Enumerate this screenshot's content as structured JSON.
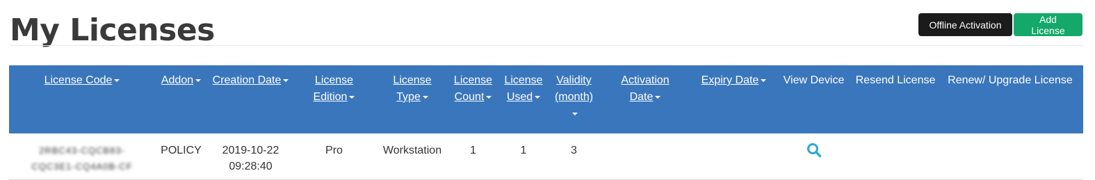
{
  "page": {
    "title": "My Licenses"
  },
  "toolbar": {
    "offline_activation_label": "Offline Activation",
    "add_license_label": "Add License"
  },
  "table": {
    "headers": [
      {
        "line1": "License Code",
        "line2": ""
      },
      {
        "line1": "Addon",
        "line2": ""
      },
      {
        "line1": "Creation Date",
        "line2": ""
      },
      {
        "line1": "License",
        "line2": "Edition"
      },
      {
        "line1": "License",
        "line2": "Type"
      },
      {
        "line1": "License",
        "line2": "Count"
      },
      {
        "line1": "License",
        "line2": "Used"
      },
      {
        "line1": "Validity",
        "line2": "(month)"
      },
      {
        "line1": "Activation",
        "line2": "Date"
      },
      {
        "line1": "Expiry Date",
        "line2": ""
      },
      {
        "line1": "View Device",
        "line2": ""
      },
      {
        "line1": "Resend License",
        "line2": ""
      },
      {
        "line1": "Renew/ Upgrade License",
        "line2": ""
      }
    ],
    "rows": [
      {
        "license_code_line1": "2RBC43-CQCB83-",
        "license_code_line2": "CQC3E1-CQ4A0B-CF",
        "addon": "POLICY",
        "creation_date": "2019-10-22",
        "creation_time": "09:28:40",
        "edition": "Pro",
        "type": "Workstation",
        "count": "1",
        "used": "1",
        "validity": "3",
        "activation_date": "",
        "expiry_date": "",
        "view_device_icon": "search-icon",
        "resend": "",
        "renew": ""
      }
    ]
  },
  "colors": {
    "header_bg": "#3a76bc",
    "add_button": "#14a86a",
    "offline_button": "#1b1b1b",
    "search_icon": "#2aa8d8"
  }
}
